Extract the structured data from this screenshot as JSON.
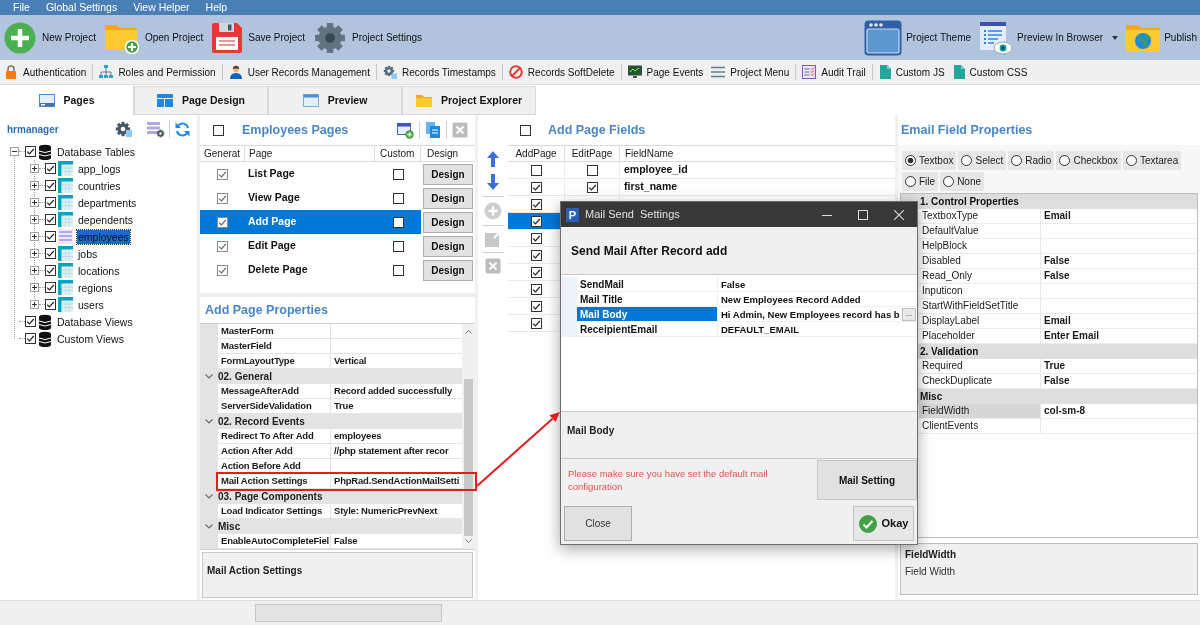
{
  "menu_bar": [
    "File",
    "Global Settings",
    "View Helper",
    "Help"
  ],
  "main_toolbar": {
    "left": [
      "New Project",
      "Open Project",
      "Save Project",
      "Project Settings"
    ],
    "right": [
      {
        "label": "Project Theme",
        "dropdown": false
      },
      {
        "label": "Preview In Browser",
        "dropdown": true
      },
      {
        "label": "Publish",
        "dropdown": false
      }
    ]
  },
  "feature_toolbar": [
    [
      "Authentication"
    ],
    [
      "Roles and Permission"
    ],
    [
      "User Records Management"
    ],
    [
      "Records Timestamps"
    ],
    [
      "Records SoftDelete"
    ],
    [
      "Page Events",
      "Project Menu"
    ],
    [
      "Audit Trail"
    ],
    [
      "Custom JS",
      "Custom CSS"
    ]
  ],
  "tabs": [
    {
      "label": "Pages",
      "selected": true
    },
    {
      "label": "Page Design",
      "selected": false
    },
    {
      "label": "Preview",
      "selected": false
    },
    {
      "label": "Project Explorer",
      "selected": false
    }
  ],
  "sidebar": {
    "title": "hrmanager",
    "tree": [
      {
        "label": "Database Tables",
        "checked": true,
        "expanded": true,
        "selected": false,
        "children": [
          {
            "label": "app_logs",
            "checked": true,
            "expanded": false,
            "selected": false
          },
          {
            "label": "countries",
            "checked": true,
            "expanded": false,
            "selected": false
          },
          {
            "label": "departments",
            "checked": true,
            "expanded": false,
            "selected": false
          },
          {
            "label": "dependents",
            "checked": true,
            "expanded": false,
            "selected": false
          },
          {
            "label": "employees",
            "checked": true,
            "expanded": false,
            "selected": true
          },
          {
            "label": "jobs",
            "checked": true,
            "expanded": false,
            "selected": false
          },
          {
            "label": "locations",
            "checked": true,
            "expanded": false,
            "selected": false
          },
          {
            "label": "regions",
            "checked": true,
            "expanded": false,
            "selected": false
          },
          {
            "label": "users",
            "checked": true,
            "expanded": false,
            "selected": false
          }
        ]
      },
      {
        "label": "Database Views",
        "checked": true,
        "selected": false
      },
      {
        "label": "Custom Views",
        "checked": true,
        "selected": false
      }
    ]
  },
  "pages_panel": {
    "title": "Employees Pages",
    "select_all": false,
    "tools": [
      {
        "disabled": false
      },
      {
        "disabled": false
      },
      {
        "disabled": true
      }
    ],
    "columns": [
      "Generat",
      "Page",
      "Custom",
      "Design"
    ],
    "rows": [
      {
        "generate": true,
        "page": "List Page",
        "custom": false,
        "design_button": "Design",
        "selected": false
      },
      {
        "generate": true,
        "page": "View Page",
        "custom": false,
        "design_button": "Design",
        "selected": false
      },
      {
        "generate": true,
        "page": "Add Page",
        "custom": false,
        "design_button": "Design",
        "selected": true
      },
      {
        "generate": true,
        "page": "Edit Page",
        "custom": false,
        "design_button": "Design",
        "selected": false
      },
      {
        "generate": true,
        "page": "Delete Page",
        "custom": false,
        "design_button": "Design",
        "selected": false
      }
    ]
  },
  "page_properties": {
    "title": "Add Page Properties",
    "rows": [
      {
        "kind": "property",
        "name": "MasterForm",
        "marked": false
      },
      {
        "kind": "property",
        "name": "MasterField",
        "marked": false
      },
      {
        "kind": "property",
        "name": "FormLayoutType",
        "value": "Vertical",
        "marked": false
      },
      {
        "kind": "category",
        "label": "02. General",
        "expanded": true
      },
      {
        "kind": "property",
        "name": "MessageAfterAdd",
        "value": "Record added successfully",
        "marked": false
      },
      {
        "kind": "property",
        "name": "ServerSideValidation",
        "value": "True",
        "marked": false
      },
      {
        "kind": "category",
        "label": "02. Record Events",
        "expanded": true
      },
      {
        "kind": "property",
        "name": "Redirect To After Add",
        "value": "employees",
        "marked": false
      },
      {
        "kind": "property",
        "name": "Action After Add",
        "value": "//php statement after recor",
        "marked": false
      },
      {
        "kind": "property",
        "name": "Action Before Add",
        "marked": false
      },
      {
        "kind": "property",
        "name": "Mail Action Settings",
        "value": "PhpRad.SendActionMailSetti",
        "marked": true
      },
      {
        "kind": "category",
        "label": "03. Page Components",
        "expanded": true
      },
      {
        "kind": "property",
        "name": "Load Indicator Settings",
        "value": "Style: NumericPrevNext",
        "marked": false
      },
      {
        "kind": "category",
        "label": "Misc",
        "expanded": true
      },
      {
        "kind": "property",
        "name": "EnableAutoCompleteFiel",
        "value": "False",
        "marked": false
      }
    ],
    "description": "Mail Action Settings"
  },
  "fields_panel": {
    "title": "Add Page Fields",
    "select_all": false,
    "tools": [
      {
        "disabled": false
      },
      {
        "disabled": false
      },
      {
        "disabled": true
      },
      {
        "disabled": true
      },
      {
        "disabled": true
      }
    ],
    "columns": [
      "AddPage",
      "EditPage",
      "FieldName"
    ],
    "rows": [
      {
        "add_page": false,
        "edit_page": false,
        "field_name": "employee_id",
        "selected": false
      },
      {
        "add_page": true,
        "edit_page": true,
        "field_name": "first_name",
        "selected": false
      },
      {
        "add_page": true,
        "selected": false
      },
      {
        "add_page": true,
        "selected": true
      },
      {
        "add_page": true,
        "selected": false
      },
      {
        "add_page": true,
        "selected": false
      },
      {
        "add_page": true,
        "selected": false
      },
      {
        "add_page": true,
        "selected": false
      },
      {
        "add_page": true,
        "selected": false
      },
      {
        "add_page": true,
        "selected": false
      }
    ]
  },
  "field_properties": {
    "title": "Email Field Properties",
    "control_types": [
      {
        "label": "Textbox",
        "selected": true
      },
      {
        "label": "Select",
        "selected": false
      },
      {
        "label": "Radio",
        "selected": false
      },
      {
        "label": "Checkbox",
        "selected": false
      },
      {
        "label": "Textarea",
        "selected": false
      },
      {
        "label": "File",
        "selected": false
      },
      {
        "label": "None",
        "selected": false
      }
    ],
    "rows": [
      {
        "kind": "category",
        "label": "1. Control Properties"
      },
      {
        "kind": "property",
        "name": "TextboxType",
        "value": "Email",
        "selected": false
      },
      {
        "kind": "property",
        "name": "DefaultValue",
        "selected": false
      },
      {
        "kind": "property",
        "name": "HelpBlock",
        "selected": false
      },
      {
        "kind": "property",
        "name": "Disabled",
        "value": "False",
        "selected": false
      },
      {
        "kind": "property",
        "name": "Read_Only",
        "value": "False",
        "selected": false
      },
      {
        "kind": "property",
        "name": "Inputicon",
        "selected": false
      },
      {
        "kind": "property",
        "name": "StartWithFieldSetTitle",
        "selected": false
      },
      {
        "kind": "property",
        "name": "DisplayLabel",
        "value": "Email",
        "selected": false
      },
      {
        "kind": "property",
        "name": "Placeholder",
        "value": "Enter Email",
        "selected": false
      },
      {
        "kind": "category",
        "label": "2. Validation"
      },
      {
        "kind": "property",
        "name": "Required",
        "value": "True",
        "selected": false
      },
      {
        "kind": "property",
        "name": "CheckDuplicate",
        "value": "False",
        "selected": false
      },
      {
        "kind": "category",
        "label": "Misc"
      },
      {
        "kind": "property",
        "name": "FieldWidth",
        "value": "col-sm-8",
        "selected": true
      },
      {
        "kind": "property",
        "name": "ClientEvents",
        "selected": false
      }
    ],
    "description": {
      "title": "FieldWidth",
      "text": "Field Width"
    }
  },
  "dialog": {
    "logo": "P",
    "title": "Mail Send  Settings",
    "heading": "Send Mail After Record add",
    "rows": [
      {
        "name": "SendMail",
        "value": "False",
        "selected": false
      },
      {
        "name": "Mail Title",
        "value": "New Employees Record Added",
        "selected": false
      },
      {
        "name": "Mail Body",
        "value": "Hi Admin, New Employees record has b",
        "selected": true,
        "editor_button": "..."
      },
      {
        "name": "ReceipientEmail",
        "value": "DEFAULT_EMAIL",
        "selected": false
      }
    ],
    "description": "Mail Body",
    "warning": "Please make sure you have set the default mail configuration",
    "mail_setting_button": "Mail Setting",
    "close_button": "Close",
    "okay_button": "Okay"
  }
}
